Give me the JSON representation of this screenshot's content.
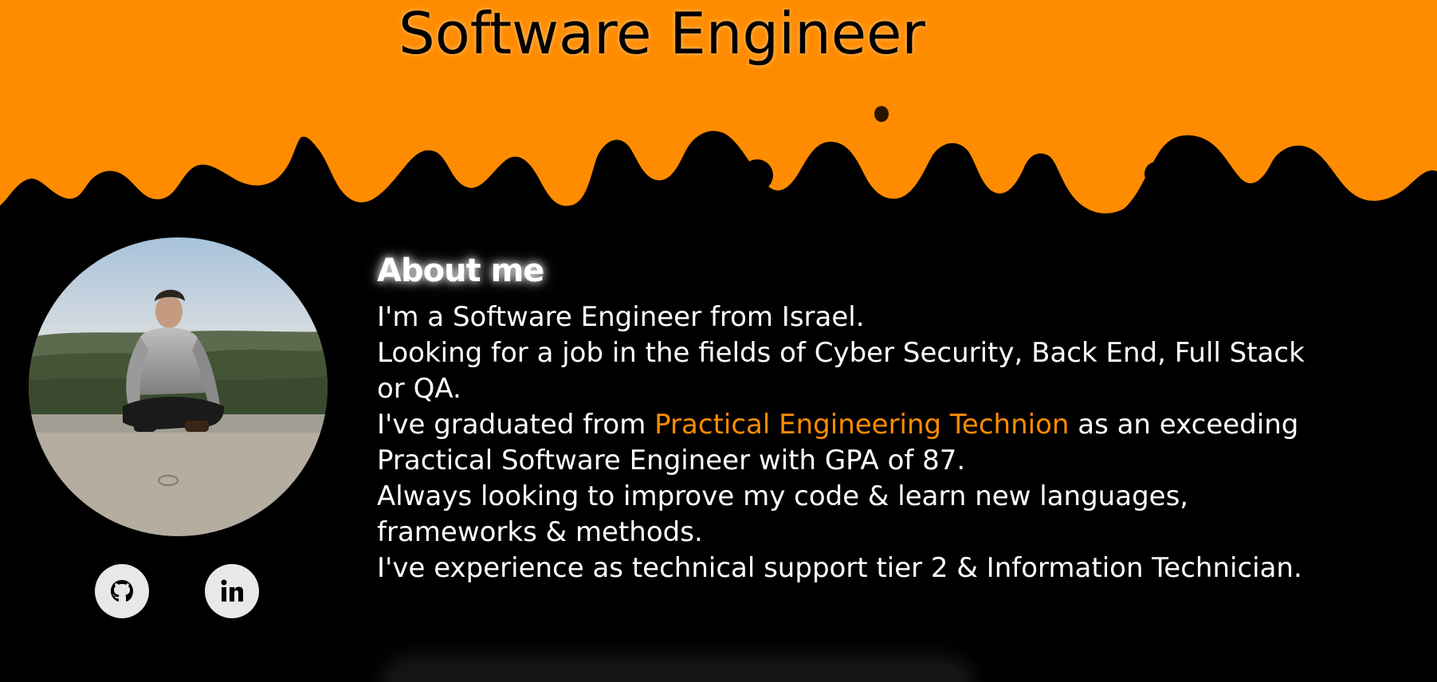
{
  "hero": {
    "title": "Software Engineer",
    "accent_color": "#ff8c00"
  },
  "profile": {
    "avatar_alt": "profile photo"
  },
  "social": {
    "github_icon": "github-icon",
    "linkedin_icon": "linkedin-icon"
  },
  "about": {
    "title": "About me",
    "line1": "I'm a Software Engineer from Israel.",
    "line2": "Looking for a job in the fields of Cyber Security, Back End, Full Stack or QA.",
    "line3_pre": "I've graduated from ",
    "line3_link": "Practical Engineering Technion",
    "line3_post": " as an exceeding Practical Software Engineer with GPA of 87.",
    "line4": "Always looking to improve my code & learn new languages, frameworks & methods.",
    "line5": "I've experience as technical support tier 2 & Information Technician."
  }
}
